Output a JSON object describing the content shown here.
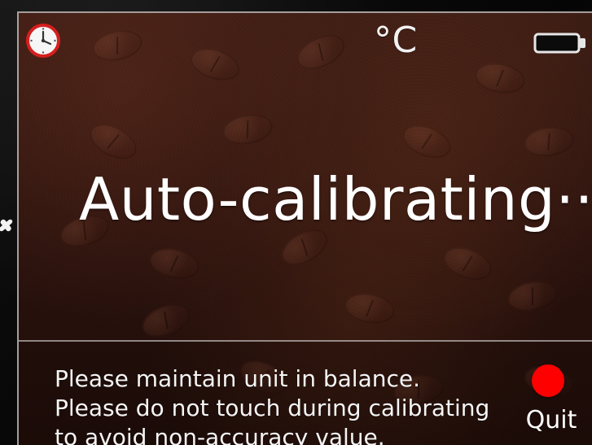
{
  "top_bar": {
    "clock_icon": "clock-icon",
    "unit": "°C",
    "battery_icon": "battery-icon"
  },
  "center": {
    "status": "Auto-calibrating···"
  },
  "bottom": {
    "instructions": [
      "Please maintain unit in balance.",
      "Please do not touch during calibrating",
      "to avoid non-accuracy value."
    ],
    "quit_label": "Quit",
    "quit_color": "#ff0000"
  },
  "colors": {
    "text": "#ffffff",
    "panel_border": "#ebebeb",
    "background_brown": "#2a120d"
  }
}
